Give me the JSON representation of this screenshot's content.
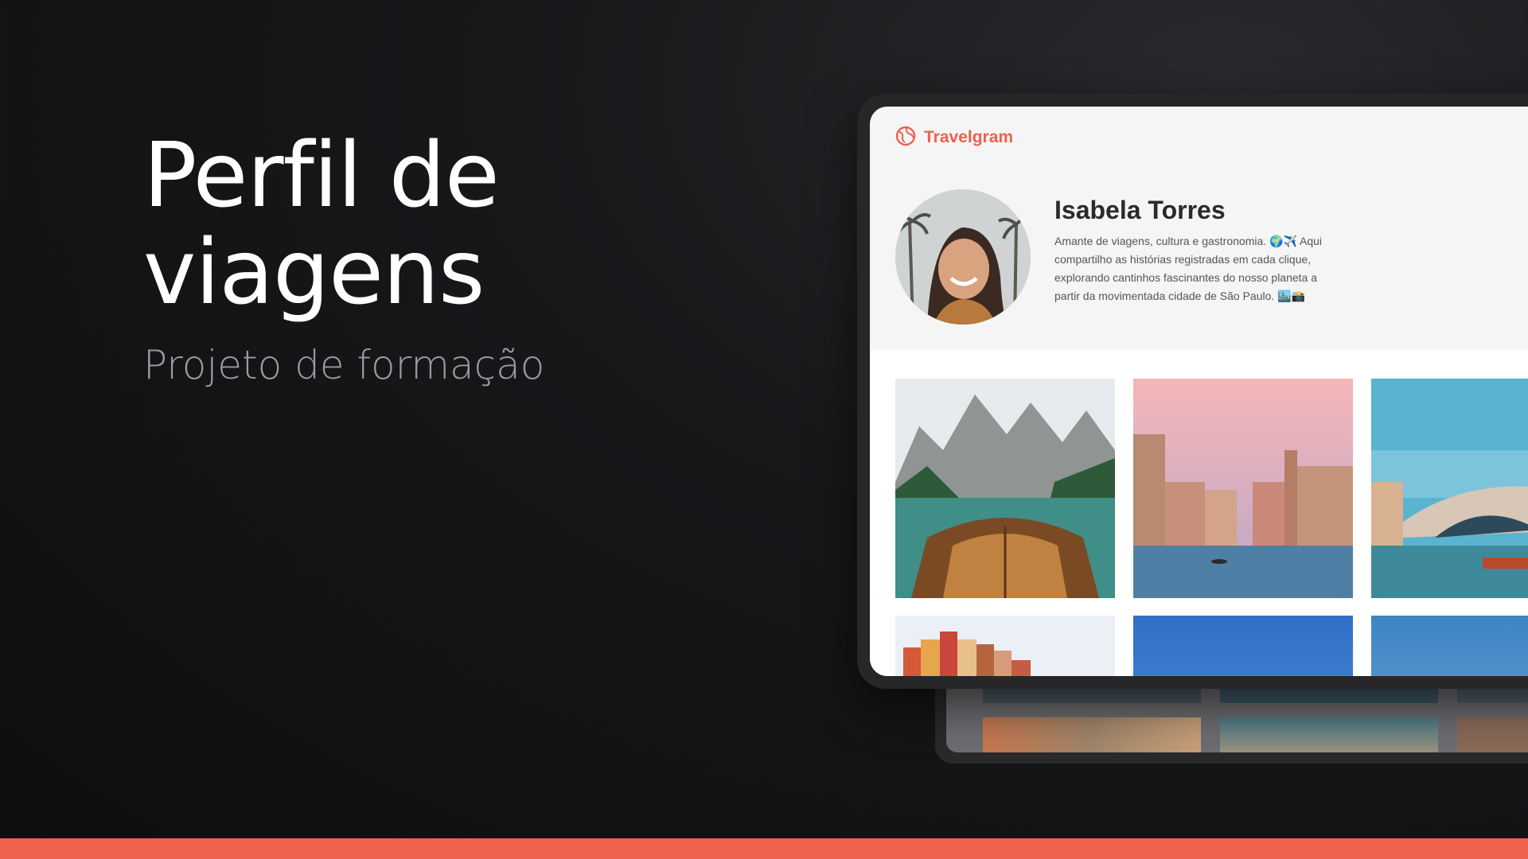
{
  "hero": {
    "title": "Perfil de viagens",
    "subtitle": "Projeto de formação"
  },
  "app": {
    "brand": "Travelgram",
    "brand_color": "#ee614d",
    "logo_icon": "globe-icon"
  },
  "profile": {
    "name": "Isabela Torres",
    "bio": "Amante de viagens, cultura e gastronomia. 🌍✈️ Aqui compartilho as histórias registradas em cada clique, explorando cantinhos fascinantes do nosso planeta a partir da movimentada cidade de São Paulo. 🏙️📸"
  },
  "gallery": {
    "photos": [
      "lake-boat-mountains",
      "venice-canal-sunset",
      "rialto-bridge",
      "colorful-cliff-village",
      "blue-sky",
      "blue-sky-coast"
    ]
  },
  "accent_bar_color": "#ee614d"
}
